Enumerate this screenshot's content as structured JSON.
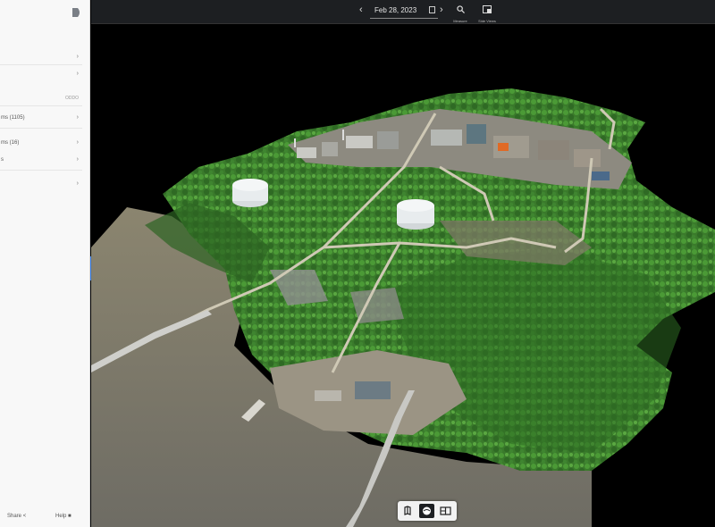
{
  "sidebar": {
    "logo_icon": "panel-toggle-icon",
    "rows": [
      {
        "label": "",
        "chevron": "›",
        "tag": ""
      },
      {
        "label": "",
        "chevron": "›",
        "tag": ""
      },
      {
        "label": "",
        "chevron": "",
        "tag": "ODDO"
      },
      {
        "label": "ms (1105)",
        "chevron": "›",
        "tag": ""
      },
      {
        "label": "ms (16)",
        "chevron": "›",
        "tag": ""
      },
      {
        "label": "s",
        "chevron": "›",
        "tag": ""
      },
      {
        "label": "",
        "chevron": "›",
        "tag": ""
      }
    ],
    "footer": {
      "share_label": "Share",
      "help_label": "Help"
    },
    "collapse_glyph": "‹"
  },
  "topbar": {
    "prev_glyph": "‹",
    "next_glyph": "›",
    "date": "Feb 28, 2023",
    "tools": [
      {
        "icon": "search-icon",
        "label": "Measure"
      },
      {
        "icon": "split-view-icon",
        "label": "Side Views"
      }
    ]
  },
  "view_switch": {
    "buttons": [
      {
        "icon": "map-2d-icon",
        "active": false
      },
      {
        "icon": "globe-3d-icon",
        "active": true
      },
      {
        "icon": "split-compare-icon",
        "active": false
      }
    ]
  },
  "colors": {
    "accent": "#2f76e0",
    "topbar_bg": "#1d1f22",
    "water": "#7a7668",
    "vegetation": "#3c7a2c"
  }
}
